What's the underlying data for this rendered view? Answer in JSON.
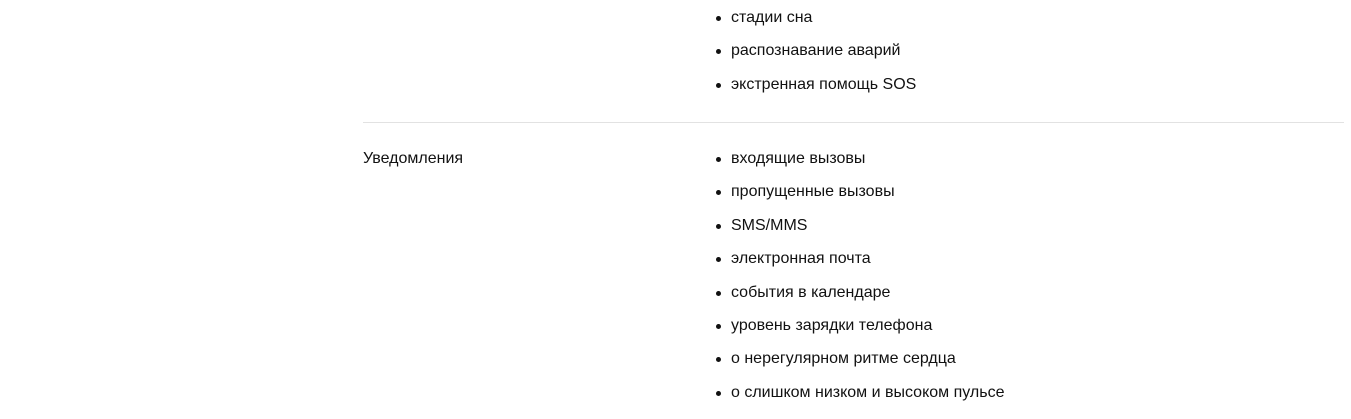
{
  "sections": [
    {
      "label": "",
      "items": [
        "стадии сна",
        "распознавание аварий",
        "экстренная помощь SOS"
      ]
    },
    {
      "label": "Уведомления",
      "items": [
        "входящие вызовы",
        "пропущенные вызовы",
        "SMS/MMS",
        "электронная почта",
        "события в календаре",
        "уровень зарядки телефона",
        "о нерегулярном ритме сердца",
        "о слишком низком и высоком пульсе"
      ]
    }
  ]
}
